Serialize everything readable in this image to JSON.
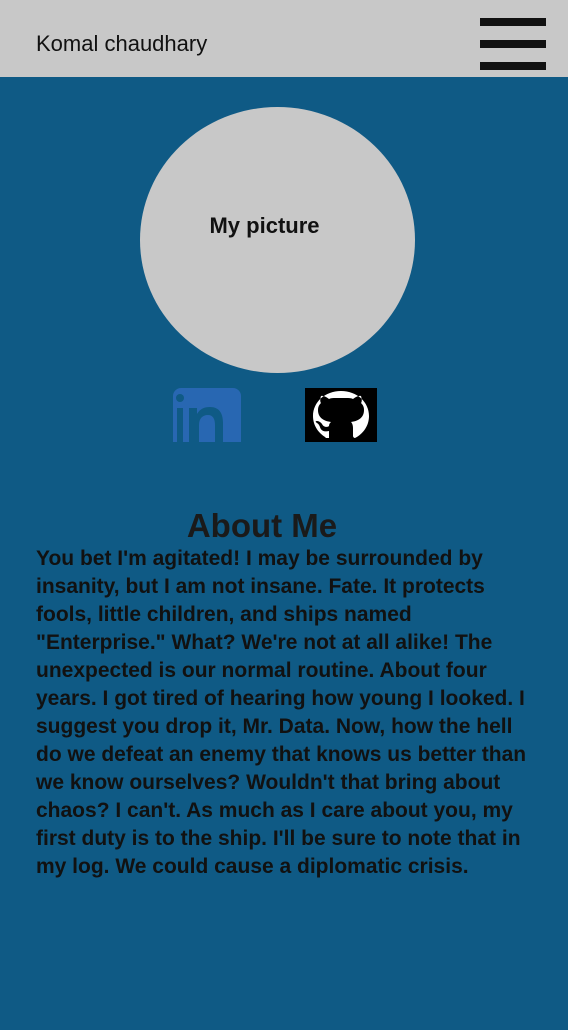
{
  "header": {
    "brand": "Komal chaudhary",
    "menu_icon": "hamburger-menu-icon"
  },
  "hero": {
    "picture_label": "My picture"
  },
  "social": {
    "linkedin_icon": "linkedin-icon",
    "github_icon": "github-icon",
    "linkedin_color": "#2867b2"
  },
  "about": {
    "title": "About Me",
    "body": "You bet I'm agitated! I may be surrounded by insanity, but I am not insane. Fate. It protects fools, little children, and ships named \"Enterprise.\" What? We're not at all alike! The unexpected is our normal routine. About four years. I got tired of hearing how young I looked. I suggest you drop it, Mr. Data. Now, how the hell do we defeat an enemy that knows us better than we know ourselves? Wouldn't that bring about chaos? I can't. As much as I care about you, my first duty is to the ship. I'll be sure to note that in my log. We could cause a diplomatic crisis."
  },
  "colors": {
    "background": "#0f5a85",
    "header": "#c8c8c8",
    "text": "#111111"
  }
}
